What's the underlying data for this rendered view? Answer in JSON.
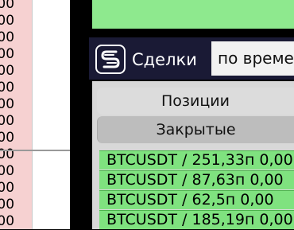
{
  "chart_axis": {
    "labels": [
      ".00",
      ".00",
      ".00",
      ".00",
      ".00",
      ".00",
      ".00",
      ".00",
      ".00",
      ".00",
      ".00",
      ".00",
      ".00",
      ".00"
    ]
  },
  "header": {
    "title": "Сделки",
    "sort_select": "по времени"
  },
  "tabs": [
    {
      "label": "Позиции"
    },
    {
      "label": "Закрытые"
    }
  ],
  "trades": [
    {
      "text": "BTCUSDT / 251,33п 0,00"
    },
    {
      "text": "BTCUSDT / 87,63п 0,00"
    },
    {
      "text": "BTCUSDT / 62,5п 0,00"
    },
    {
      "text": "BTCUSDT / 185,19п 0,00"
    }
  ],
  "colors": {
    "row_green": "#7fe27f",
    "header_navy": "#1a1a35",
    "axis_pink": "#f6d1d1"
  }
}
